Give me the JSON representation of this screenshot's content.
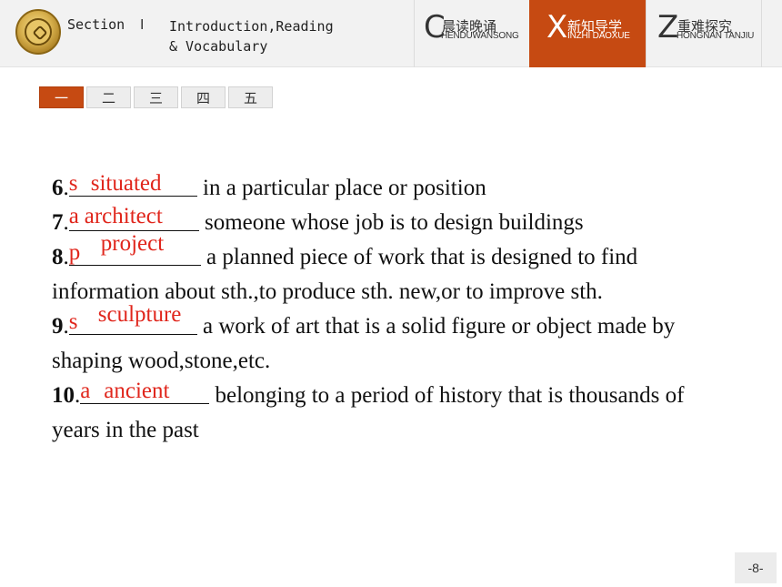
{
  "header": {
    "section_label": "Section",
    "section_sep": "Ⅰ",
    "section_title": "Introduction,Reading\n& Vocabulary",
    "tabs": [
      {
        "letter": "C",
        "cn": "晨读晚诵",
        "pinyin": "HENDUWANSONG"
      },
      {
        "letter": "X",
        "cn": "新知导学",
        "pinyin": "INZHI DAOXUE"
      },
      {
        "letter": "Z",
        "cn": "重难探究",
        "pinyin": "HONGNAN TANJIU"
      }
    ]
  },
  "num_tabs": [
    "一",
    "二",
    "三",
    "四",
    "五"
  ],
  "items": [
    {
      "num": "6",
      "letter": "s",
      "answer": "situated",
      "text": " in a particular place or position"
    },
    {
      "num": "7",
      "letter": "a",
      "answer": "architect",
      "text": " someone whose job is to design buildings"
    },
    {
      "num": "8",
      "letter": "p",
      "answer": "project",
      "text": " a planned piece of work that is designed to find",
      "cont": "information about sth.,to produce sth. new,or to improve sth."
    },
    {
      "num": "9",
      "letter": "s",
      "answer": "sculpture",
      "text": " a work of art that is a solid figure or object made by",
      "cont": "shaping wood,stone,etc."
    },
    {
      "num": "10",
      "letter": "a",
      "answer": "ancient",
      "text": " belonging to a period of history that is thousands of",
      "cont": "years in the past"
    }
  ],
  "colors": {
    "accent": "#c64a12",
    "answer_red": "#e0261c"
  },
  "page_number": "-8-"
}
